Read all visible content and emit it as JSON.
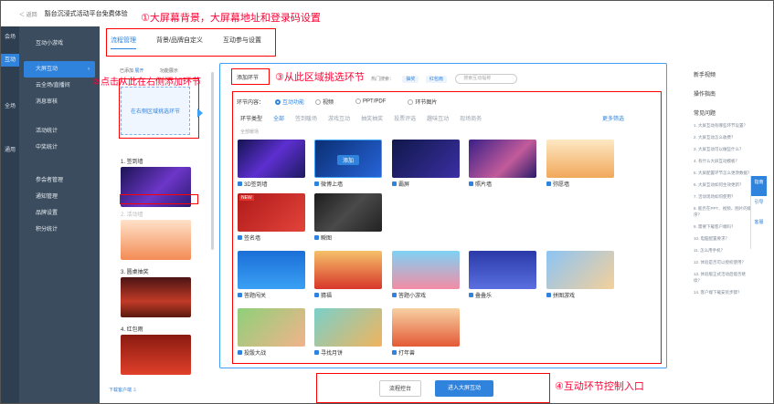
{
  "header": {
    "back": "＜ 返回",
    "title": "豁台沉浸式活动平台免费体验"
  },
  "notes": {
    "n1": "①大屏幕背景，大屏幕地址和登录码设置",
    "n2": "②点击从此在右侧添加环节",
    "n3": "③从此区域挑选环节",
    "n4": "④互动环节控制入口"
  },
  "rail": [
    "会场",
    "互动",
    "全场",
    "通用"
  ],
  "sidebar": {
    "items": [
      {
        "label": "互动小游戏"
      },
      {
        "label": "大屏互动"
      },
      {
        "label": "云全场/直播间"
      },
      {
        "label": "消息审核"
      },
      {
        "label": "活动统计"
      },
      {
        "label": "中奖统计"
      },
      {
        "label": "参会者管理"
      },
      {
        "label": "通知管理"
      },
      {
        "label": "品牌设置"
      },
      {
        "label": "积分统计"
      }
    ],
    "download": "下载客户端 ⇩"
  },
  "tabs": [
    "流程管理",
    "背景/品牌自定义",
    "互动参与设置"
  ],
  "left": {
    "added": "已添加",
    "added_btn": "展开",
    "toggle_label": "功能展示",
    "slot": "在右侧区域挑选环节",
    "steps": [
      {
        "label": "1. 签到墙"
      },
      {
        "label": "2. 活动墙"
      },
      {
        "label": "3. 圆桌抽奖"
      },
      {
        "label": "4. 红包雨"
      }
    ]
  },
  "picker": {
    "add_btn": "添加环节",
    "hot": "热门搜索：",
    "chip1": "抽奖",
    "chip2": "红包雨",
    "search_ph": "搜索互动幅称",
    "content_label": "环节内容：",
    "radios": [
      "互动功能",
      "视频",
      "PPT/PDF",
      "环节图片"
    ],
    "type_label": "环节类型",
    "types": [
      "全部",
      "签到暖场",
      "游戏互动",
      "抽奖抽奖",
      "投票评选",
      "趣味互动",
      "现场商务"
    ],
    "more": "更多筛选",
    "filter_hint": "全部暖场",
    "add_overlay": "添加",
    "new_badge": "NEW",
    "cards": [
      {
        "cap": "3D签到墙"
      },
      {
        "cap": "微博上墙"
      },
      {
        "cap": "霸屏"
      },
      {
        "cap": "照片墙"
      },
      {
        "cap": "弥愿墙"
      },
      {
        "cap": "签名墙"
      },
      {
        "cap": "瞬图"
      },
      {
        "cap": "答题闯关"
      },
      {
        "cap": "猜福"
      },
      {
        "cap": "答题小游戏"
      },
      {
        "cap": "叠叠乐"
      },
      {
        "cap": "拼图游戏"
      },
      {
        "cap": "投骰大战"
      },
      {
        "cap": "寻找月饼"
      },
      {
        "cap": "打年兽"
      }
    ]
  },
  "right": {
    "t1": "新手视频",
    "t2": "操作指南",
    "t3": "常见问题",
    "faqs": [
      "1. 大屏互动有哪些环节设置？",
      "2. 大屏互动怎么收费？",
      "3. 大屏互动可以做些什么？",
      "4. 有什么大屏互动模板？",
      "5. 大屏配置环节怎么更改数据？",
      "6. 大屏互动如何生效更新？",
      "7. 活动现场如何使用？",
      "8. 能否在PPT、视频、图片的顺序？",
      "9. 需要下载客户端吗？",
      "10. 电脑配置要求？",
      "11. 怎么用手机？",
      "12. 体验是否可以授权使用？",
      "13. 体验版正式活动后能否继续？",
      "14. 客户端下载安装步骤？"
    ]
  },
  "float": [
    "指南",
    "引导",
    "客服"
  ],
  "footer": {
    "b1": "流程控台",
    "b2": "进入大屏互动"
  }
}
